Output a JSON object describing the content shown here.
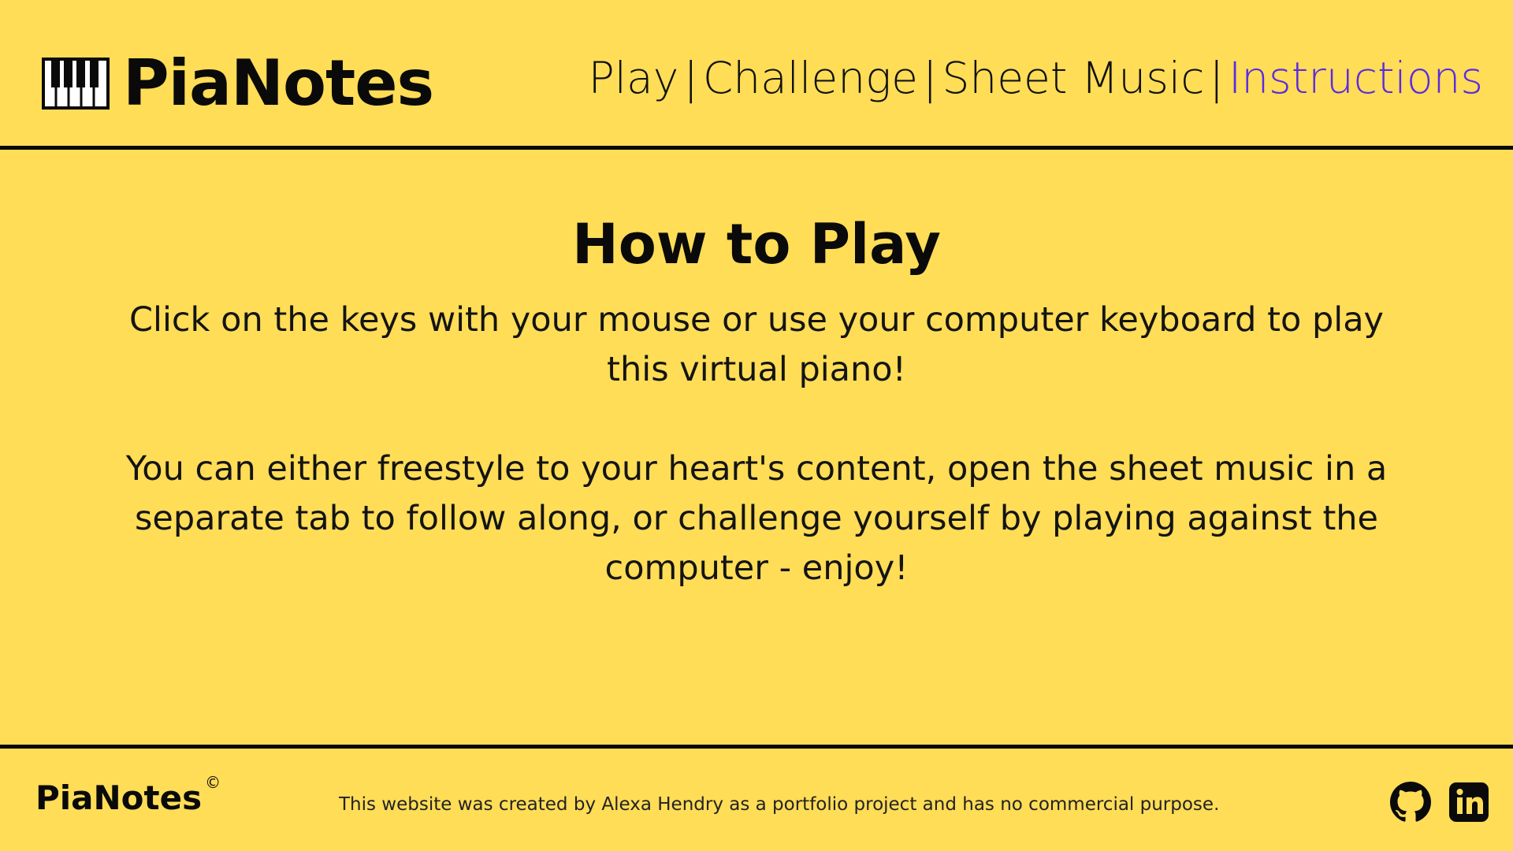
{
  "header": {
    "brand": "PiaNotes",
    "nav": [
      {
        "label": "Play",
        "active": false
      },
      {
        "label": "Challenge",
        "active": false
      },
      {
        "label": "Sheet Music",
        "active": false
      },
      {
        "label": "Instructions",
        "active": true
      }
    ],
    "separator": "|"
  },
  "main": {
    "title": "How to Play",
    "paragraphs": [
      "Click on the keys with your mouse or use your computer keyboard to play this virtual piano!",
      "You can either freestyle to your heart's content, open the sheet music in a separate tab to follow along, or challenge yourself by playing against the computer - enjoy!"
    ]
  },
  "footer": {
    "brand": "PiaNotes",
    "copyright_symbol": "©",
    "note": "This website was created by Alexa Hendry as a portfolio project and has no commercial purpose.",
    "social": [
      {
        "icon": "github-icon"
      },
      {
        "icon": "linkedin-icon"
      }
    ]
  },
  "colors": {
    "background": "#ffdd57",
    "text": "#111111",
    "active_link": "#5b2be0"
  }
}
